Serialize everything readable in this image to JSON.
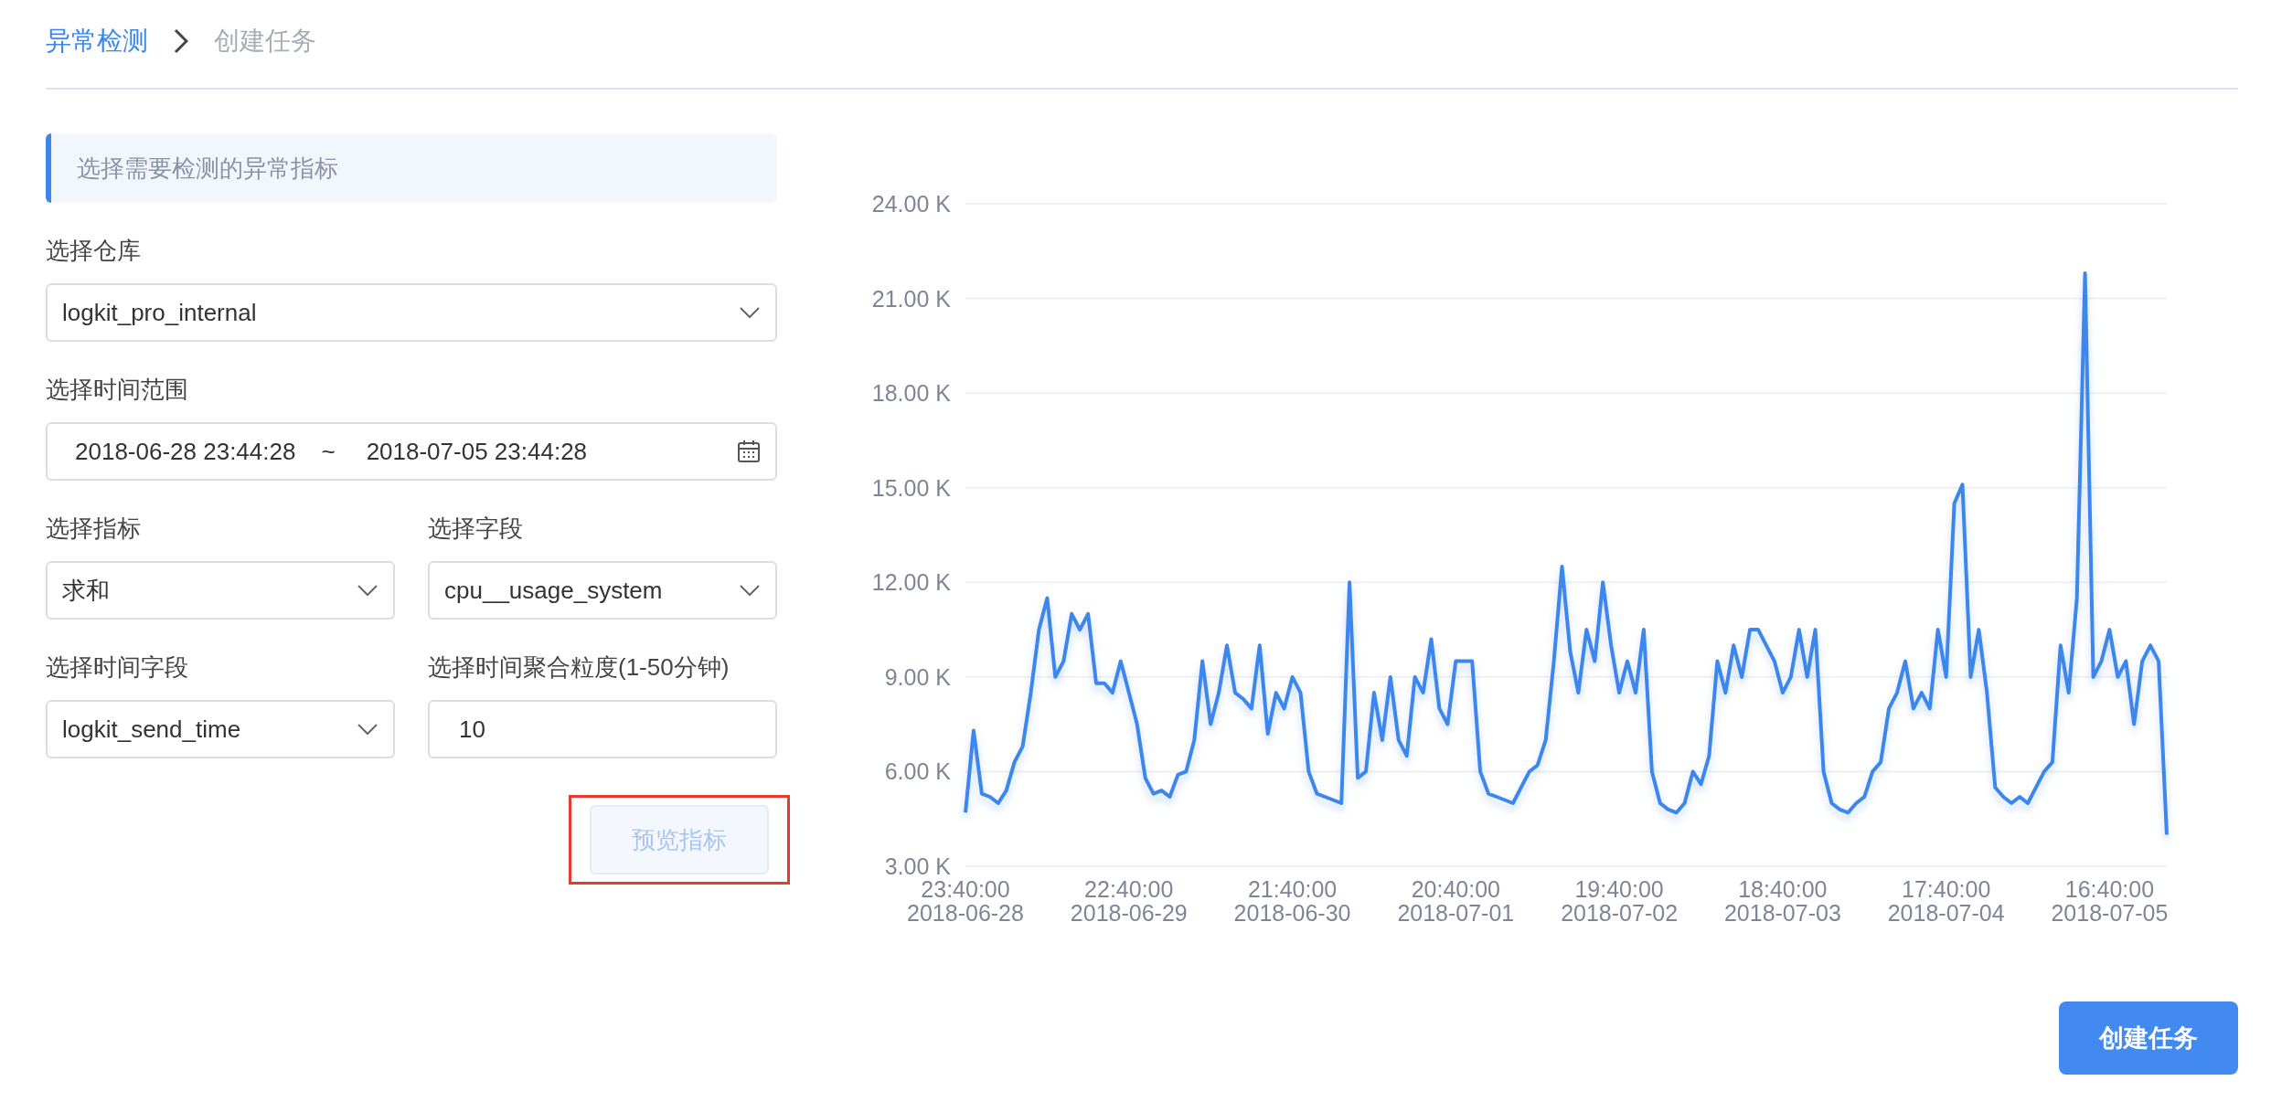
{
  "breadcrumb": [
    {
      "label": "异常检测",
      "current": false
    },
    {
      "label": "创建任务",
      "current": true
    }
  ],
  "section_title": "选择需要检测的异常指标",
  "form_rows": [
    [
      {
        "kind": "select",
        "label": "选择仓库",
        "value": "logkit_pro_internal"
      }
    ],
    [
      {
        "kind": "daterange",
        "label": "选择时间范围",
        "start": "2018-06-28 23:44:28",
        "separator": "~",
        "end": "2018-07-05 23:44:28"
      }
    ],
    [
      {
        "kind": "select",
        "label": "选择指标",
        "value": "求和"
      },
      {
        "kind": "select",
        "label": "选择字段",
        "value": "cpu__usage_system"
      }
    ],
    [
      {
        "kind": "select",
        "label": "选择时间字段",
        "value": "logkit_send_time"
      },
      {
        "kind": "text",
        "label": "选择时间聚合粒度(1-50分钟)",
        "value": "10"
      }
    ]
  ],
  "preview_button": {
    "label": "预览指标",
    "disabled": true,
    "highlighted": true
  },
  "chart_data": {
    "type": "line",
    "ylim": [
      3,
      24
    ],
    "yticks": [
      {
        "value": 3,
        "label": "3.00 K"
      },
      {
        "value": 6,
        "label": "6.00 K"
      },
      {
        "value": 9,
        "label": "9.00 K"
      },
      {
        "value": 12,
        "label": "12.00 K"
      },
      {
        "value": 15,
        "label": "15.00 K"
      },
      {
        "value": 18,
        "label": "18.00 K"
      },
      {
        "value": 21,
        "label": "21.00 K"
      },
      {
        "value": 24,
        "label": "24.00 K"
      }
    ],
    "grid": true,
    "categories": [
      "23:40:00\n2018-06-28",
      null,
      null,
      null,
      null,
      null,
      null,
      null,
      null,
      null,
      null,
      null,
      null,
      null,
      null,
      null,
      null,
      null,
      null,
      null,
      "22:40:00\n2018-06-29",
      null,
      null,
      null,
      null,
      null,
      null,
      null,
      null,
      null,
      null,
      null,
      null,
      null,
      null,
      null,
      null,
      null,
      null,
      null,
      "21:40:00\n2018-06-30",
      null,
      null,
      null,
      null,
      null,
      null,
      null,
      null,
      null,
      null,
      null,
      null,
      null,
      null,
      null,
      null,
      null,
      null,
      null,
      "20:40:00\n2018-07-01",
      null,
      null,
      null,
      null,
      null,
      null,
      null,
      null,
      null,
      null,
      null,
      null,
      null,
      null,
      null,
      null,
      null,
      null,
      null,
      "19:40:00\n2018-07-02",
      null,
      null,
      null,
      null,
      null,
      null,
      null,
      null,
      null,
      null,
      null,
      null,
      null,
      null,
      null,
      null,
      null,
      null,
      null,
      "18:40:00\n2018-07-03",
      null,
      null,
      null,
      null,
      null,
      null,
      null,
      null,
      null,
      null,
      null,
      null,
      null,
      null,
      null,
      null,
      null,
      null,
      null,
      "17:40:00\n2018-07-04",
      null,
      null,
      null,
      null,
      null,
      null,
      null,
      null,
      null,
      null,
      null,
      null,
      null,
      null,
      null,
      null,
      null,
      null,
      null,
      "16:40:00\n2018-07-05",
      null,
      null,
      null,
      null,
      null,
      null,
      null
    ],
    "series": [
      {
        "color": "#3d86ee",
        "values": [
          4.7,
          7.3,
          5.3,
          5.2,
          5.0,
          5.4,
          6.3,
          6.8,
          8.5,
          10.5,
          11.5,
          9.0,
          9.5,
          11.0,
          10.5,
          11.0,
          8.8,
          8.8,
          8.5,
          9.5,
          8.5,
          7.5,
          5.8,
          5.3,
          5.4,
          5.2,
          5.9,
          6.0,
          7.0,
          9.5,
          7.5,
          8.5,
          10.0,
          8.5,
          8.3,
          8.0,
          10.0,
          7.2,
          8.5,
          8.0,
          9.0,
          8.5,
          6.0,
          5.3,
          5.2,
          5.1,
          5.0,
          12.0,
          5.8,
          6.0,
          8.5,
          7.0,
          9.0,
          7.0,
          6.5,
          9.0,
          8.5,
          10.2,
          8.0,
          7.5,
          9.5,
          9.5,
          9.5,
          6.0,
          5.3,
          5.2,
          5.1,
          5.0,
          5.5,
          6.0,
          6.2,
          7.0,
          9.5,
          12.5,
          9.8,
          8.5,
          10.5,
          9.5,
          12.0,
          10.0,
          8.5,
          9.5,
          8.5,
          10.5,
          6.0,
          5.0,
          4.8,
          4.7,
          5.0,
          6.0,
          5.6,
          6.5,
          9.5,
          8.5,
          10.0,
          9.0,
          10.5,
          10.5,
          10.0,
          9.5,
          8.5,
          9.0,
          10.5,
          9.0,
          10.5,
          6.0,
          5.0,
          4.8,
          4.7,
          5.0,
          5.2,
          6.0,
          6.3,
          8.0,
          8.5,
          9.5,
          8.0,
          8.5,
          8.0,
          10.5,
          9.0,
          14.5,
          15.1,
          9.0,
          10.5,
          8.5,
          5.5,
          5.2,
          5.0,
          5.2,
          5.0,
          5.5,
          6.0,
          6.3,
          10.0,
          8.5,
          11.5,
          21.8,
          9.0,
          9.5,
          10.5,
          9.0,
          9.5,
          7.5,
          9.5,
          10.0,
          9.5,
          4.0
        ]
      }
    ]
  },
  "create_button": {
    "label": "创建任务"
  }
}
